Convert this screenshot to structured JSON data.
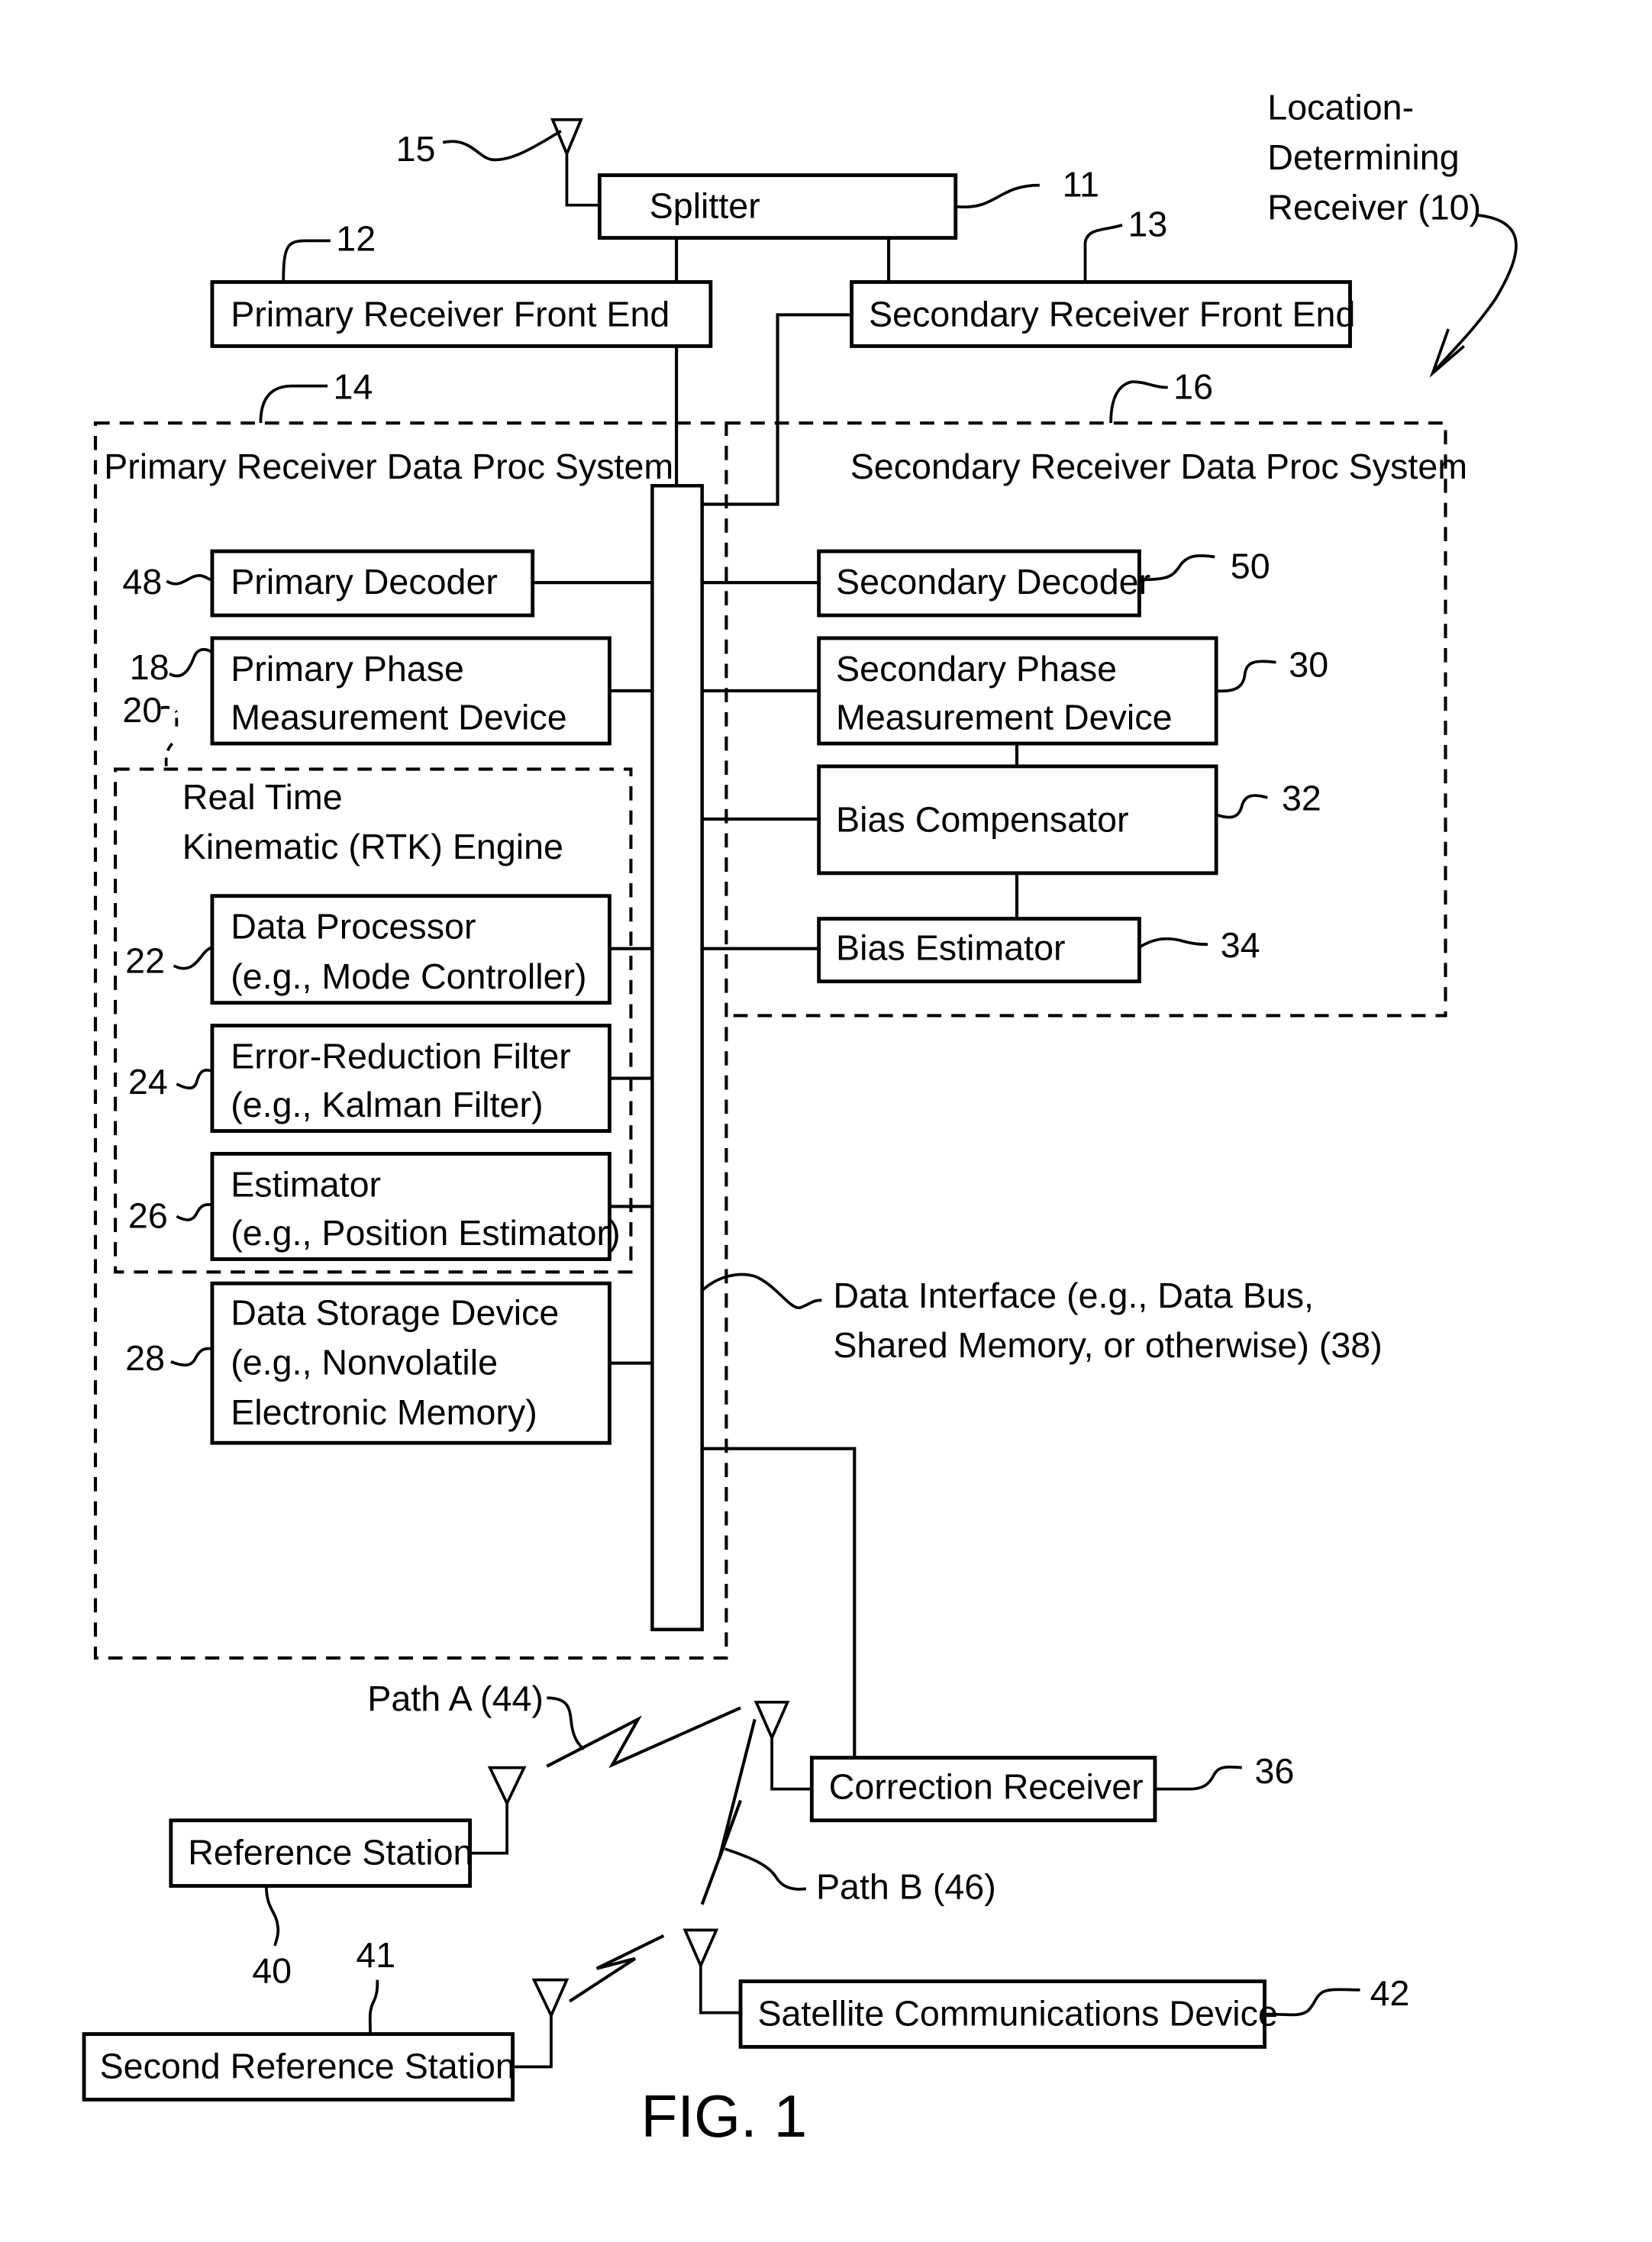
{
  "figure": {
    "caption": "FIG. 1",
    "device_label_lines": [
      "Location-",
      "Determining",
      "Receiver (10)"
    ]
  },
  "blocks": {
    "splitter": {
      "lines": [
        "Splitter"
      ],
      "ref": "11"
    },
    "primary_front_end": {
      "lines": [
        "Primary Receiver Front End"
      ],
      "ref": "12"
    },
    "secondary_front_end": {
      "lines": [
        "Secondary Receiver Front End"
      ],
      "ref": "13"
    },
    "primary_system": {
      "lines": [
        "Primary Receiver Data Proc System"
      ],
      "ref": "14"
    },
    "secondary_system": {
      "lines": [
        "Secondary Receiver Data Proc System"
      ],
      "ref": "16"
    },
    "primary_decoder": {
      "lines": [
        "Primary Decoder"
      ],
      "ref": "48"
    },
    "primary_phase": {
      "lines": [
        "Primary Phase",
        "Measurement Device"
      ],
      "ref": "18"
    },
    "rtk_engine": {
      "lines": [
        "Real Time",
        "Kinematic (RTK) Engine"
      ],
      "ref": "20"
    },
    "data_processor": {
      "lines": [
        "Data Processor",
        "(e.g., Mode Controller)"
      ],
      "ref": "22"
    },
    "error_filter": {
      "lines": [
        "Error-Reduction Filter",
        "(e.g., Kalman Filter)"
      ],
      "ref": "24"
    },
    "estimator": {
      "lines": [
        "Estimator",
        "(e.g., Position Estimator)"
      ],
      "ref": "26"
    },
    "data_storage": {
      "lines": [
        "Data Storage Device",
        "(e.g., Nonvolatile",
        "Electronic Memory)"
      ],
      "ref": "28"
    },
    "secondary_decoder": {
      "lines": [
        "Secondary Decoder"
      ],
      "ref": "50"
    },
    "secondary_phase": {
      "lines": [
        "Secondary Phase",
        "Measurement Device"
      ],
      "ref": "30"
    },
    "bias_compensator": {
      "lines": [
        "Bias Compensator"
      ],
      "ref": "32"
    },
    "bias_estimator": {
      "lines": [
        "Bias Estimator"
      ],
      "ref": "34"
    },
    "data_interface": {
      "lines": [
        "Data Interface (e.g., Data Bus,",
        "Shared Memory, or otherwise) (38)"
      ]
    },
    "correction_receiver": {
      "lines": [
        "Correction Receiver"
      ],
      "ref": "36"
    },
    "reference_station": {
      "lines": [
        "Reference Station"
      ],
      "ref": "40"
    },
    "second_reference_station": {
      "lines": [
        "Second Reference Station"
      ],
      "ref": "41"
    },
    "satellite_device": {
      "lines": [
        "Satellite Communications Device"
      ],
      "ref": "42"
    },
    "antenna": {
      "ref": "15"
    },
    "path_a": {
      "lines": [
        "Path A (44)"
      ]
    },
    "path_b": {
      "lines": [
        "Path B (46)"
      ]
    }
  }
}
